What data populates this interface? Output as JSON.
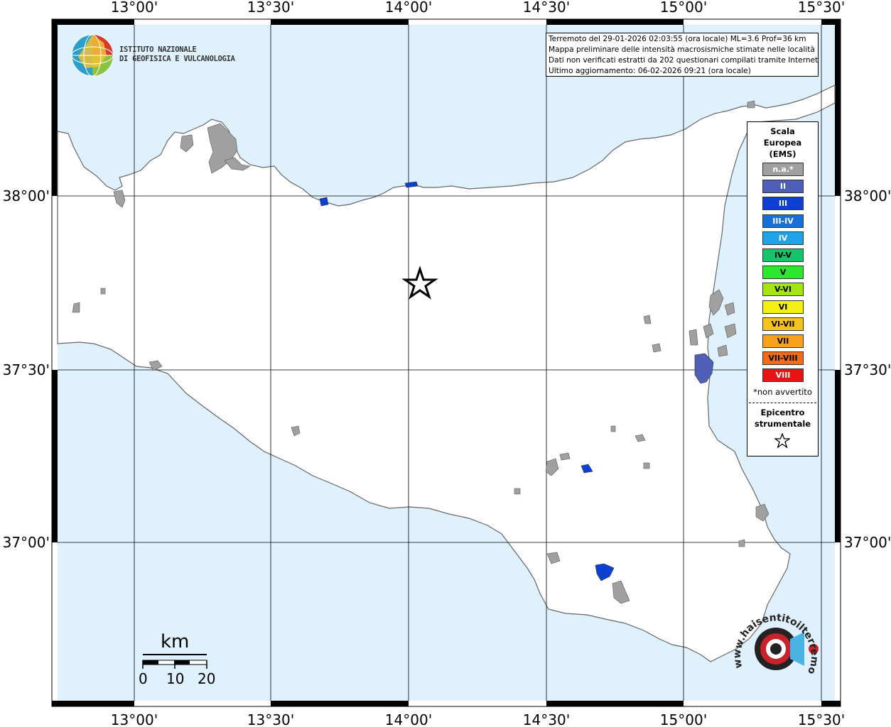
{
  "header": {
    "info_lines": [
      "Terremoto del 29-01-2026 02:03:55 (ora locale) ML=3.6 Prof=36 km",
      "Mappa preliminare delle intensità macrosismiche stimate nelle località",
      "Dati non verificati estratti da 202 questionari compilati tramite Internet.",
      "Ultimo aggiornamento: 06-02-2026 09:21 (ora locale)"
    ]
  },
  "institute": {
    "line1": "ISTITUTO NAZIONALE",
    "line2": "DI GEOFISICA E VULCANOLOGIA"
  },
  "axes": {
    "lon_labels": [
      "13°00'",
      "13°30'",
      "14°00'",
      "14°30'",
      "15°00'",
      "15°30'"
    ],
    "lat_labels": [
      "38°00'",
      "37°30'",
      "37°00'"
    ]
  },
  "legend": {
    "title_lines": [
      "Scala",
      "Europea",
      "(EMS)"
    ],
    "items": [
      {
        "label": "n.a.*",
        "color": "#a0a0a0",
        "text_color": "#ffffff"
      },
      {
        "label": "II",
        "color": "#4f5fb8",
        "text_color": "#ffffff"
      },
      {
        "label": "III",
        "color": "#0d3fd0",
        "text_color": "#ffffff"
      },
      {
        "label": "III-IV",
        "color": "#1a6fd6",
        "text_color": "#ffffff"
      },
      {
        "label": "IV",
        "color": "#1ea3e8",
        "text_color": "#ffffff"
      },
      {
        "label": "IV-V",
        "color": "#16c46c",
        "text_color": "#000000"
      },
      {
        "label": "V",
        "color": "#2ce82c",
        "text_color": "#000000"
      },
      {
        "label": "V-VI",
        "color": "#a4e614",
        "text_color": "#000000"
      },
      {
        "label": "VI",
        "color": "#f5f014",
        "text_color": "#000000"
      },
      {
        "label": "VI-VII",
        "color": "#f7c21a",
        "text_color": "#000000"
      },
      {
        "label": "VII",
        "color": "#f7a21a",
        "text_color": "#000000"
      },
      {
        "label": "VII-VIII",
        "color": "#f56a14",
        "text_color": "#000000"
      },
      {
        "label": "VIII",
        "color": "#e81414",
        "text_color": "#ffffff"
      }
    ],
    "note": "*non avvertito",
    "epicenter_lines": [
      "Epicentro",
      "strumentale"
    ]
  },
  "scale_bar": {
    "unit": "km",
    "ticks": [
      "0",
      "10",
      "20"
    ]
  },
  "watermark": {
    "text": "www.haisentitoilterremoto.it"
  },
  "colors": {
    "sea": "#dff1fc",
    "land": "#ffffff",
    "coast": "#666666",
    "locality": "#a0a0a0"
  }
}
